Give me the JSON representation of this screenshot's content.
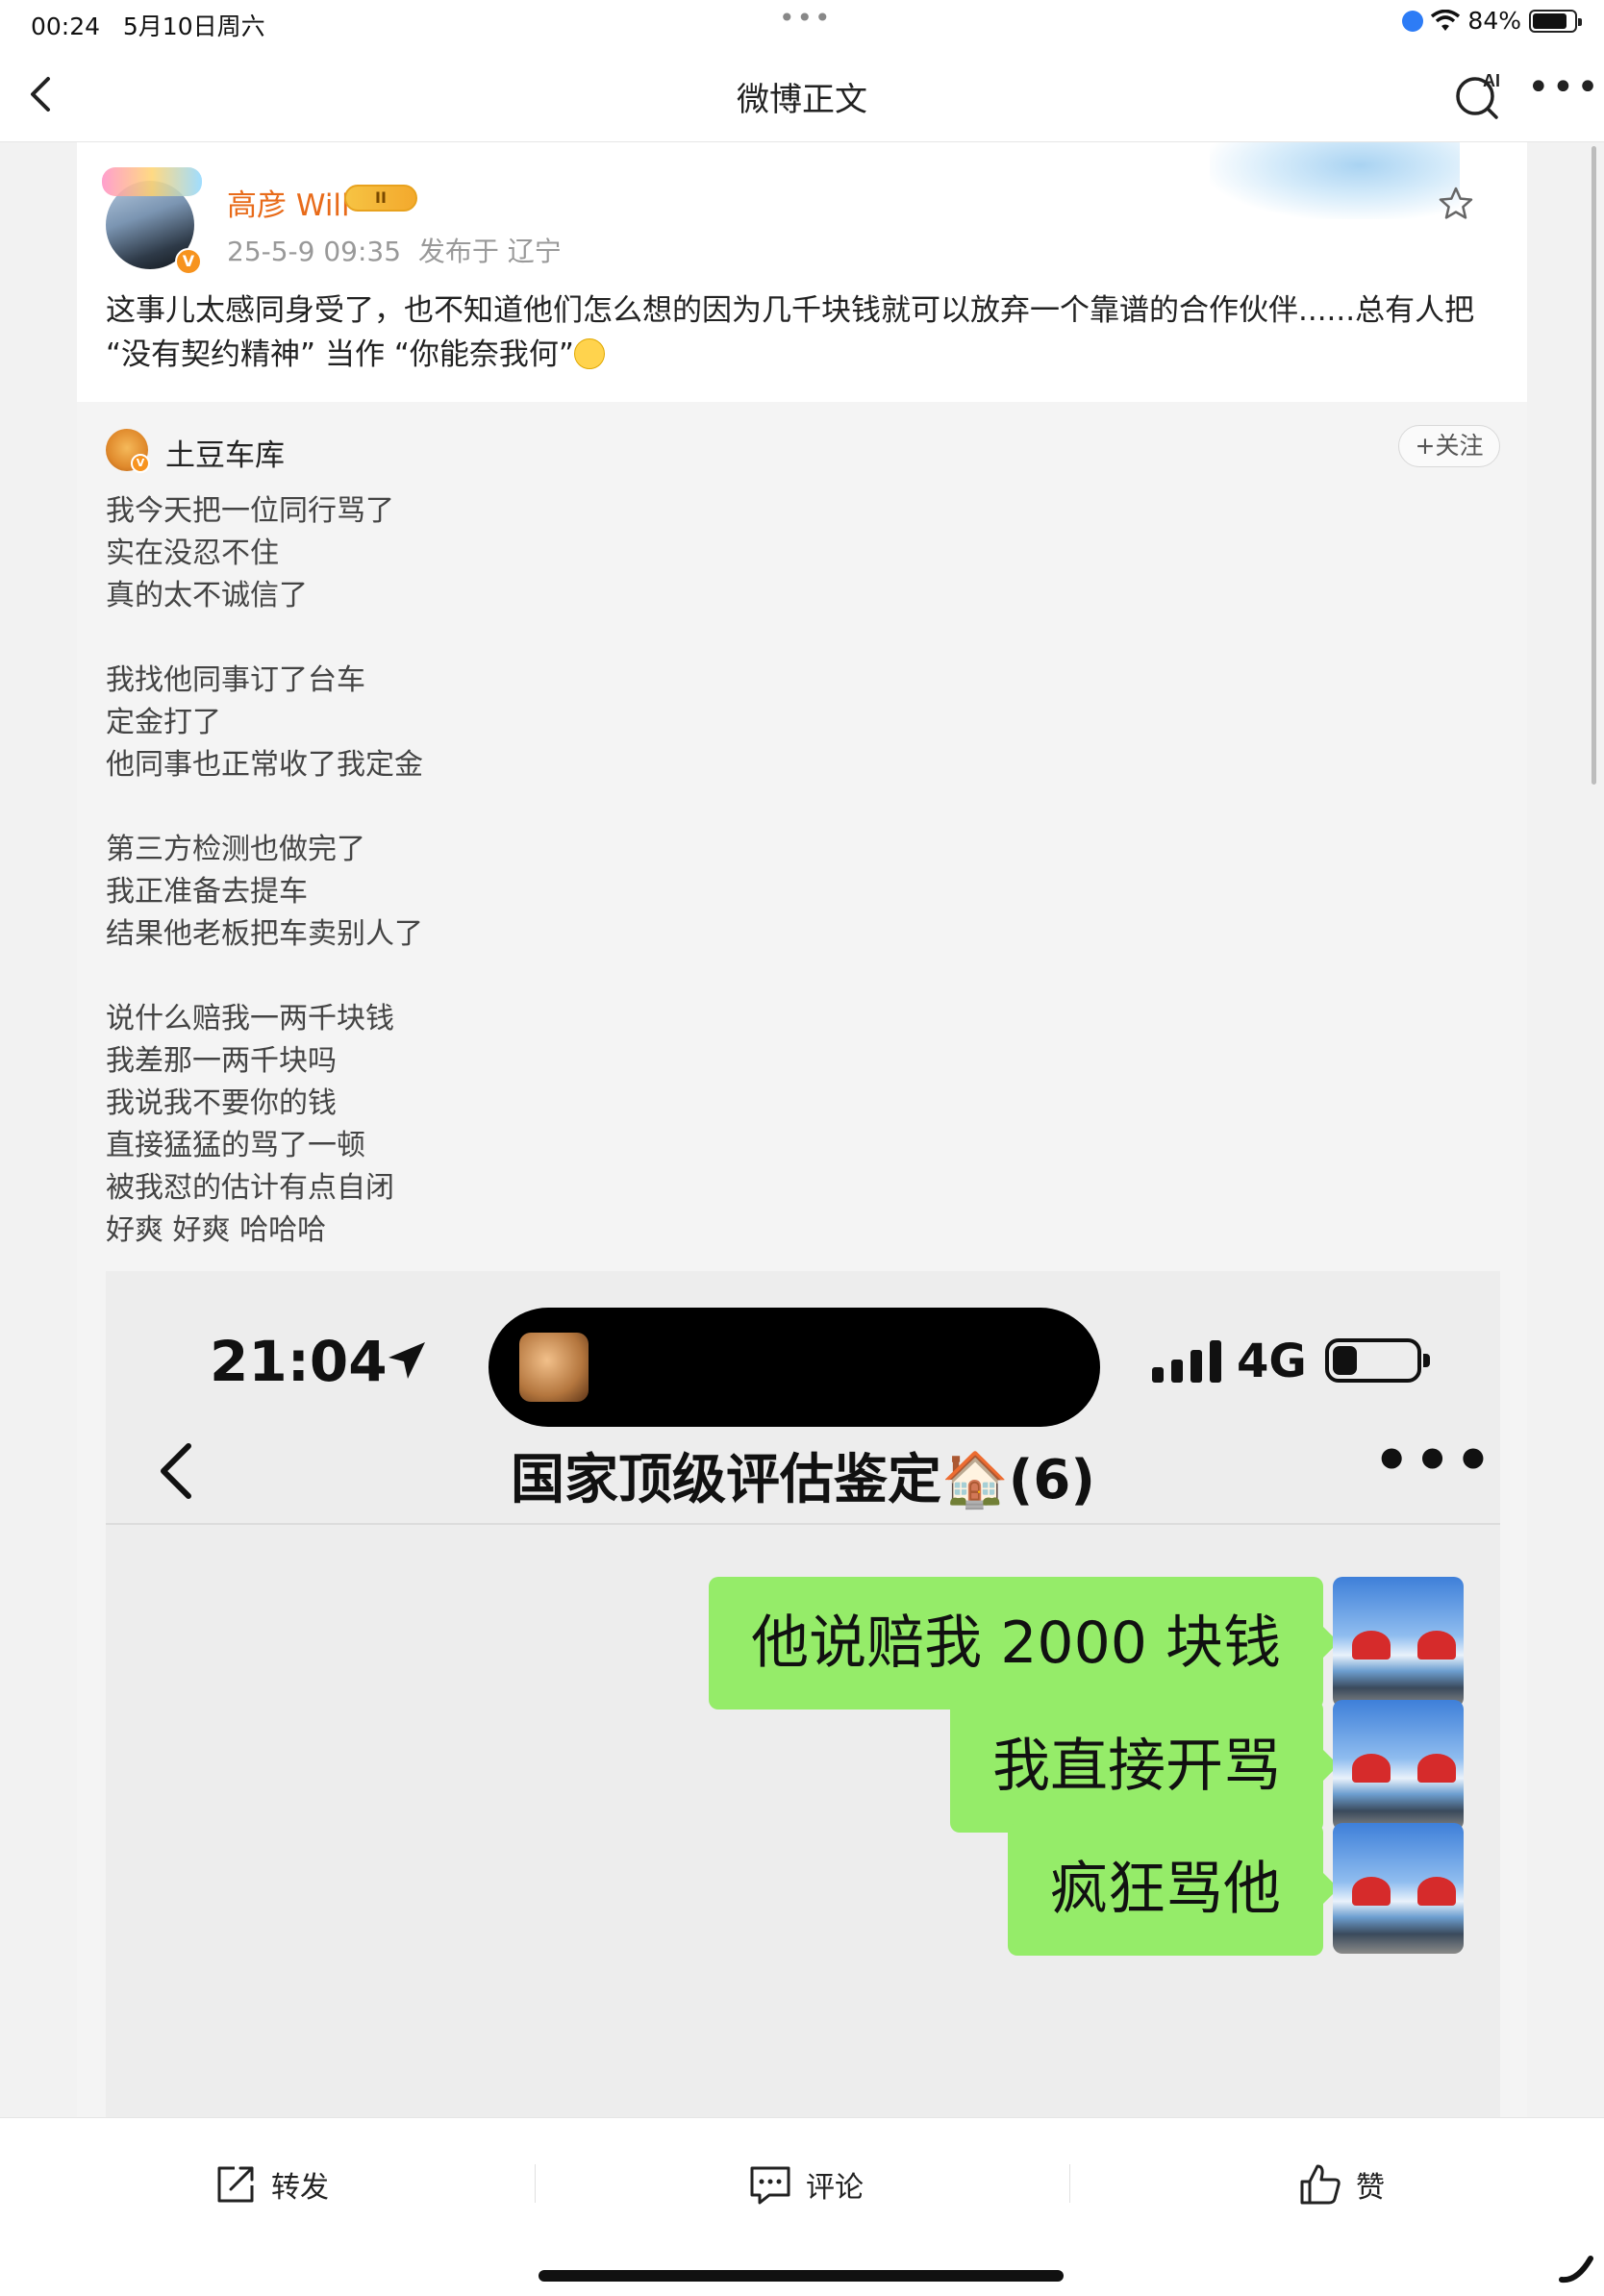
{
  "status_bar": {
    "time": "00:24",
    "date": "5月10日周六",
    "dots": "•••",
    "battery_percent": "84%",
    "battery_level": 0.84
  },
  "nav": {
    "title": "微博正文",
    "ai_label": "AI",
    "more": "•••"
  },
  "post": {
    "author": "高彦 Will",
    "vip_level": "II",
    "verified_badge": "V",
    "time": "25-5-9 09:35",
    "location": "发布于 辽宁",
    "text": "这事儿太感同身受了，也不知道他们怎么想的因为几千块钱就可以放弃一个靠谱的合作伙伴......总有人把 “没有契约精神” 当作 “你能奈我何”"
  },
  "repost": {
    "author": "土豆车库",
    "follow_label": "+关注",
    "lines": [
      "我今天把一位同行骂了",
      "实在没忍不住",
      "真的太不诚信了",
      "",
      "我找他同事订了台车",
      "定金打了",
      "他同事也正常收了我定金",
      "",
      "第三方检测也做完了",
      "我正准备去提车",
      "结果他老板把车卖别人了",
      "",
      "说什么赔我一两千块钱",
      "我差那一两千块吗",
      "我说我不要你的钱",
      "直接猛猛的骂了一顿",
      "被我怼的估计有点自闭",
      "好爽 好爽 哈哈哈"
    ]
  },
  "screenshot": {
    "time": "21:04",
    "network": "4G",
    "battery_level": 0.3,
    "chat_title": "国家顶级评估鉴定🏠(6)",
    "more": "•••",
    "messages": [
      "他说赔我 2000 块钱",
      "我直接开骂",
      "疯狂骂他"
    ]
  },
  "bottom_bar": {
    "repost_label": "转发",
    "comment_label": "评论",
    "like_label": "赞"
  },
  "colors": {
    "username": "#e86b1a",
    "bubble": "#95ec69",
    "vip_gold": "#f6c343"
  }
}
